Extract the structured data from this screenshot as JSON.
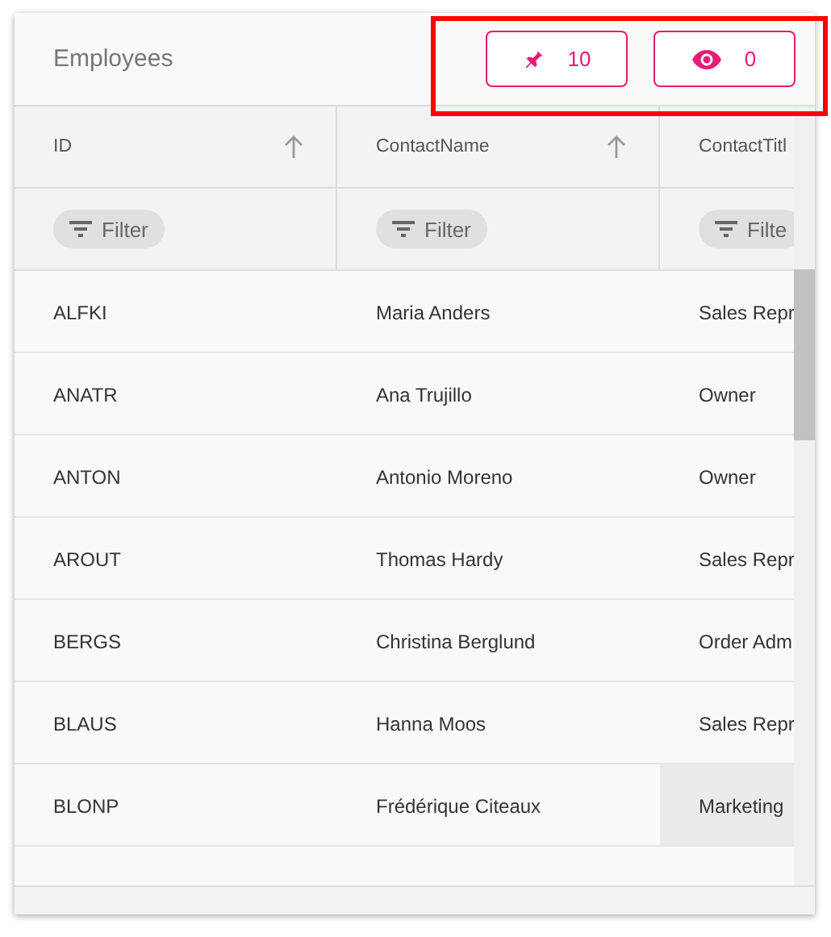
{
  "grid": {
    "title": "Employees",
    "toolbar_buttons": [
      {
        "kind": "pin",
        "label": "10"
      },
      {
        "kind": "eye",
        "label": "0"
      }
    ],
    "highlighted_toolbar": true,
    "columns": [
      {
        "label": "ID",
        "sort_icon": true,
        "filter": "Filter"
      },
      {
        "label": "ContactName",
        "sort_icon": true,
        "filter": "Filter"
      },
      {
        "label": "ContactTitl",
        "sort_icon": false,
        "filter": "Filte"
      }
    ],
    "rows": [
      {
        "cells": [
          {
            "text": "ALFKI",
            "selected": false
          },
          {
            "text": "Maria Anders",
            "selected": false
          },
          {
            "text": "Sales Repr",
            "selected": false
          }
        ]
      },
      {
        "cells": [
          {
            "text": "ANATR",
            "selected": false
          },
          {
            "text": "Ana Trujillo",
            "selected": false
          },
          {
            "text": "Owner",
            "selected": false
          }
        ]
      },
      {
        "cells": [
          {
            "text": "ANTON",
            "selected": false
          },
          {
            "text": "Antonio Moreno",
            "selected": false
          },
          {
            "text": "Owner",
            "selected": false
          }
        ]
      },
      {
        "cells": [
          {
            "text": "AROUT",
            "selected": false
          },
          {
            "text": "Thomas Hardy",
            "selected": false
          },
          {
            "text": "Sales Repr",
            "selected": false
          }
        ]
      },
      {
        "cells": [
          {
            "text": "BERGS",
            "selected": false
          },
          {
            "text": "Christina Berglund",
            "selected": false
          },
          {
            "text": "Order Adm",
            "selected": false
          }
        ]
      },
      {
        "cells": [
          {
            "text": "BLAUS",
            "selected": false
          },
          {
            "text": "Hanna Moos",
            "selected": false
          },
          {
            "text": "Sales Repr",
            "selected": false
          }
        ]
      },
      {
        "cells": [
          {
            "text": "BLONP",
            "selected": false
          },
          {
            "text": "Frédérique Citeaux",
            "selected": false
          },
          {
            "text": "Marketing",
            "selected": true
          }
        ]
      }
    ]
  }
}
